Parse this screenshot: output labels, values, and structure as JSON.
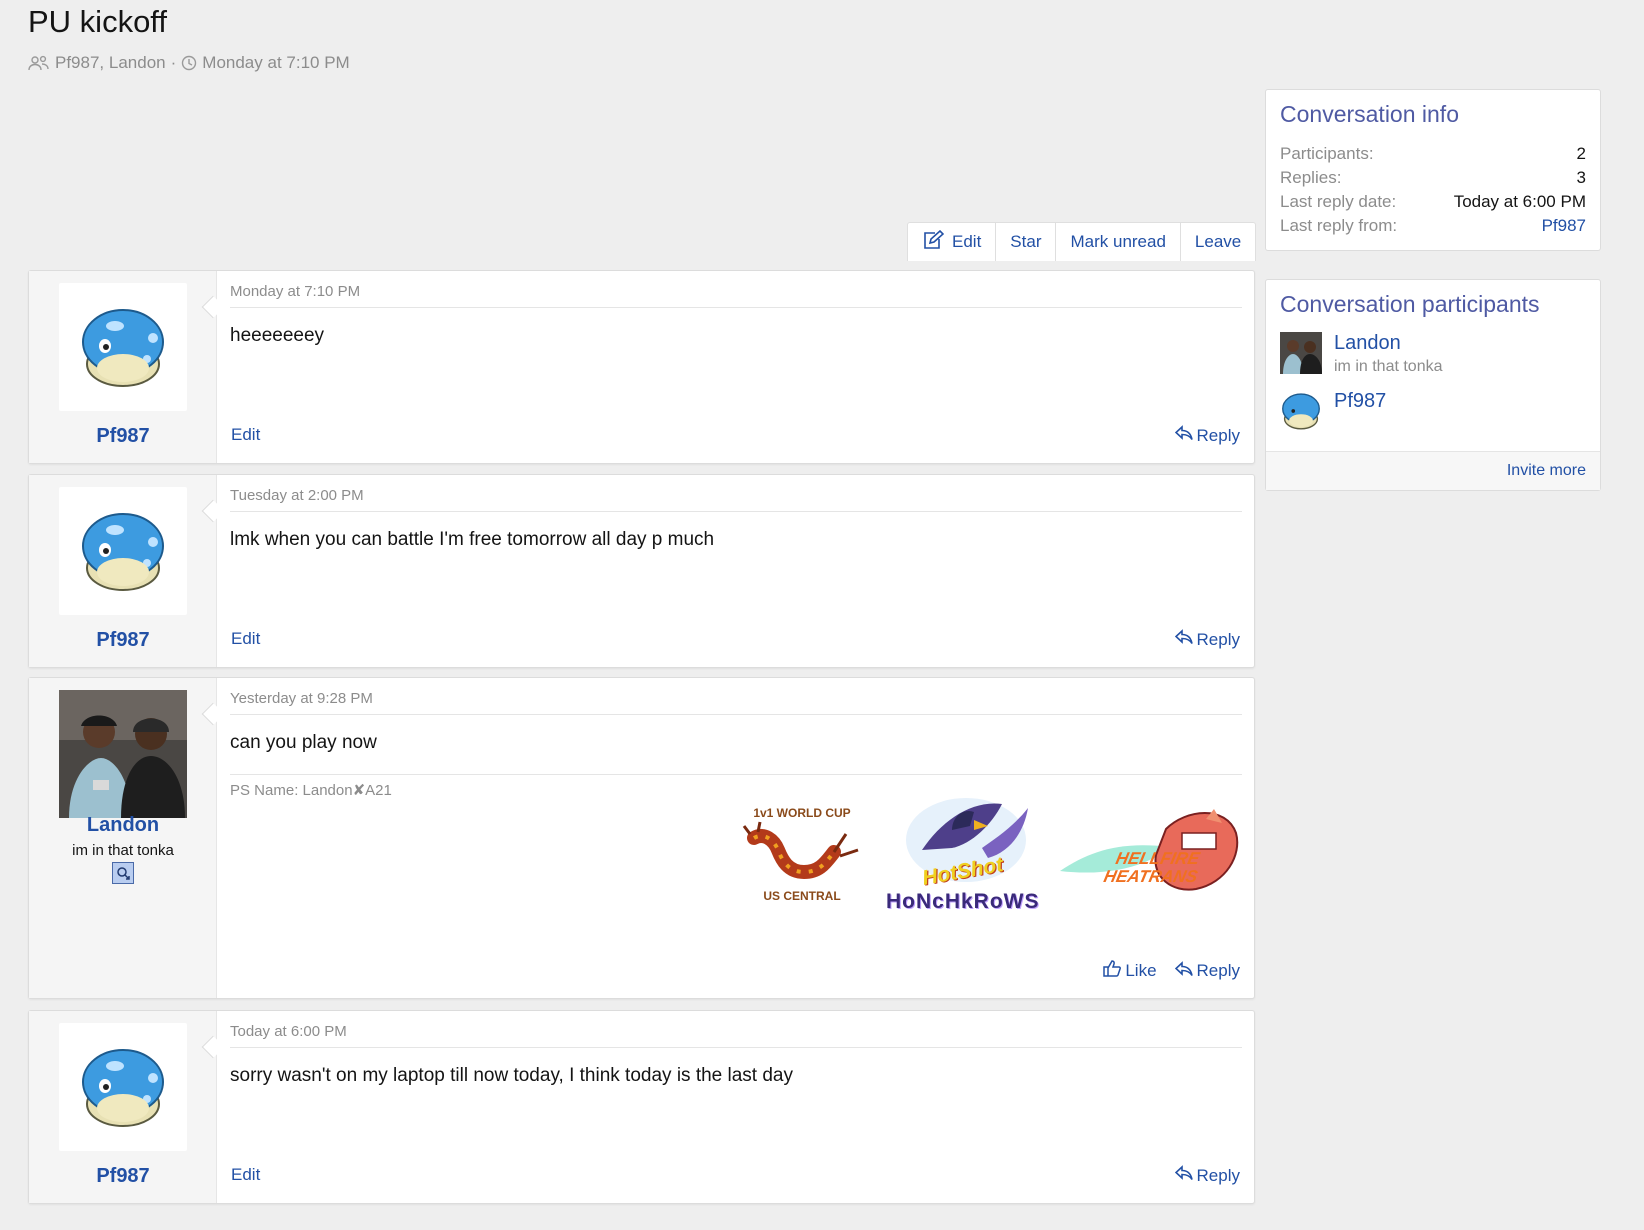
{
  "page": {
    "title": "PU kickoff",
    "participants_text": "Pf987, Landon",
    "separator": "·",
    "started": "Monday at 7:10 PM"
  },
  "toolbar": {
    "edit": "Edit",
    "star": "Star",
    "mark_unread": "Mark unread",
    "leave": "Leave"
  },
  "messages": [
    {
      "user": "Pf987",
      "date": "Monday at 7:10 PM",
      "body": "heeeeeeey",
      "edit": "Edit",
      "reply": "Reply"
    },
    {
      "user": "Pf987",
      "date": "Tuesday at 2:00 PM",
      "body": "lmk when you can battle I'm free tomorrow all day p much",
      "edit": "Edit",
      "reply": "Reply"
    },
    {
      "user": "Landon",
      "user_title": "im in that tonka",
      "date": "Yesterday at 9:28 PM",
      "body": "can you play now",
      "signature": "PS Name: Landon✘A21",
      "banners": {
        "world_cup_top": "1v1 WORLD CUP",
        "world_cup_bottom": "US CENTRAL",
        "honchkrows_line1": "HotShot",
        "honchkrows_line2": "HoNcHkRoWS",
        "heatrans_line1": "HELLFIRE",
        "heatrans_line2": "HEATRANS"
      },
      "like": "Like",
      "reply": "Reply"
    },
    {
      "user": "Pf987",
      "date": "Today at 6:00 PM",
      "body": "sorry wasn't on my laptop till now today, I think today is the last day",
      "edit": "Edit",
      "reply": "Reply"
    }
  ],
  "sidebar": {
    "info": {
      "title": "Conversation info",
      "rows": [
        {
          "label": "Participants:",
          "value": "2"
        },
        {
          "label": "Replies:",
          "value": "3"
        },
        {
          "label": "Last reply date:",
          "value": "Today at 6:00 PM"
        },
        {
          "label": "Last reply from:",
          "value": "Pf987"
        }
      ]
    },
    "participants": {
      "title": "Conversation participants",
      "list": [
        {
          "name": "Landon",
          "title": "im in that tonka"
        },
        {
          "name": "Pf987"
        }
      ],
      "invite": "Invite more"
    }
  },
  "colors": {
    "link": "#2250a5",
    "heading": "#4f5aa3",
    "background": "#eeeeee",
    "muted": "#8c8c8c"
  },
  "icons": [
    "participants-icon",
    "clock-icon",
    "edit-icon",
    "reply-icon",
    "like-icon",
    "gender-icon"
  ]
}
